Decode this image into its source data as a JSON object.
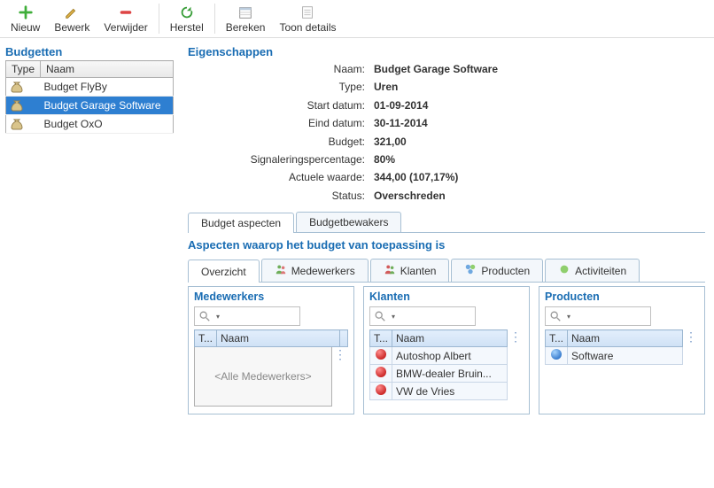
{
  "toolbar": {
    "new": "Nieuw",
    "edit": "Bewerk",
    "delete": "Verwijder",
    "restore": "Herstel",
    "calculate": "Bereken",
    "showDetails": "Toon details"
  },
  "budgets": {
    "title": "Budgetten",
    "columns": {
      "type": "Type",
      "name": "Naam"
    },
    "rows": [
      {
        "name": "Budget FlyBy",
        "selected": false
      },
      {
        "name": "Budget Garage Software",
        "selected": true
      },
      {
        "name": "Budget OxO",
        "selected": false
      }
    ]
  },
  "properties": {
    "title": "Eigenschappen",
    "rows": [
      {
        "label": "Naam:",
        "value": "Budget Garage Software"
      },
      {
        "label": "Type:",
        "value": "Uren"
      },
      {
        "label": "Start datum:",
        "value": "01-09-2014"
      },
      {
        "label": "Eind datum:",
        "value": "30-11-2014"
      },
      {
        "label": "Budget:",
        "value": "321,00"
      },
      {
        "label": "Signaleringspercentage:",
        "value": "80%"
      },
      {
        "label": "Actuele waarde:",
        "value": "344,00 (107,17%)"
      },
      {
        "label": "Status:",
        "value": "Overschreden"
      }
    ]
  },
  "primaryTabs": {
    "aspects": "Budget aspecten",
    "watchers": "Budgetbewakers"
  },
  "aspectSection": {
    "title": "Aspecten waarop het budget van toepassing is",
    "tabs": {
      "overview": "Overzicht",
      "employees": "Medewerkers",
      "clients": "Klanten",
      "products": "Producten",
      "activities": "Activiteiten"
    }
  },
  "panels": {
    "columns": {
      "type": "T...",
      "name": "Naam"
    },
    "employees": {
      "title": "Medewerkers",
      "placeholder": "<Alle Medewerkers>"
    },
    "clients": {
      "title": "Klanten",
      "rows": [
        {
          "name": "Autoshop Albert"
        },
        {
          "name": "BMW-dealer Bruin..."
        },
        {
          "name": "VW de Vries"
        }
      ]
    },
    "products": {
      "title": "Producten",
      "rows": [
        {
          "name": "Software"
        }
      ]
    }
  }
}
